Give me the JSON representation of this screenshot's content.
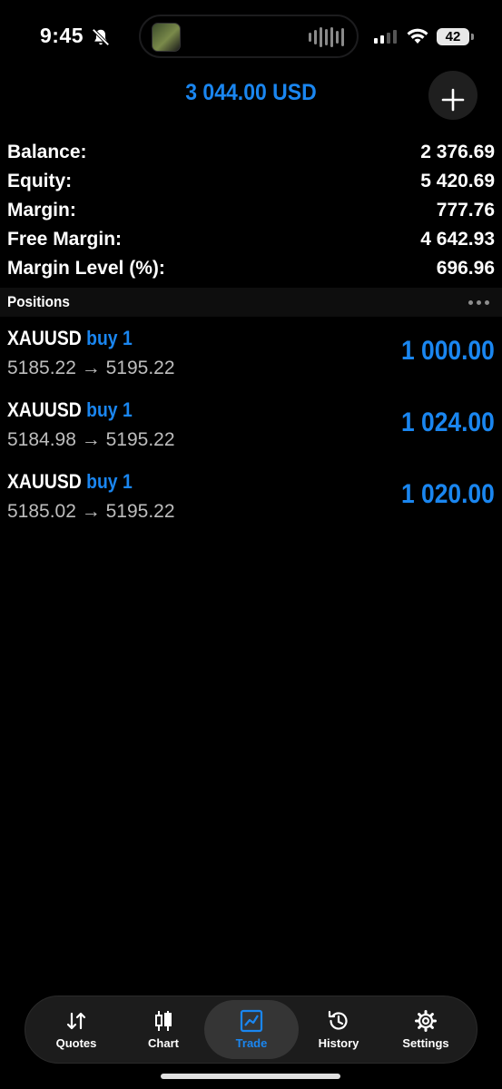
{
  "status_bar": {
    "time": "9:45",
    "battery": "42",
    "icons": [
      "bell-slash-icon",
      "signal-icon",
      "wifi-icon",
      "battery-icon"
    ]
  },
  "header": {
    "title": "3 044.00 USD",
    "add_icon": "plus-icon"
  },
  "account": [
    {
      "label": "Balance:",
      "value": "2 376.69"
    },
    {
      "label": "Equity:",
      "value": "5 420.69"
    },
    {
      "label": "Margin:",
      "value": "777.76"
    },
    {
      "label": "Free Margin:",
      "value": "4 642.93"
    },
    {
      "label": "Margin Level (%):",
      "value": "696.96"
    }
  ],
  "positions": {
    "title": "Positions",
    "arrow": "→",
    "items": [
      {
        "symbol": "XAUUSD",
        "side": "buy 1",
        "open": "5185.22",
        "current": "5195.22",
        "profit": "1 000.00"
      },
      {
        "symbol": "XAUUSD",
        "side": "buy 1",
        "open": "5184.98",
        "current": "5195.22",
        "profit": "1 024.00"
      },
      {
        "symbol": "XAUUSD",
        "side": "buy 1",
        "open": "5185.02",
        "current": "5195.22",
        "profit": "1 020.00"
      }
    ]
  },
  "tabbar": {
    "active": "Trade",
    "accent": "#1a86f0",
    "tabs": [
      {
        "label": "Quotes",
        "icon": "quotes-arrows-icon"
      },
      {
        "label": "Chart",
        "icon": "candlestick-icon"
      },
      {
        "label": "Trade",
        "icon": "trade-chart-icon"
      },
      {
        "label": "History",
        "icon": "history-clock-icon"
      },
      {
        "label": "Settings",
        "icon": "gear-icon"
      }
    ]
  }
}
